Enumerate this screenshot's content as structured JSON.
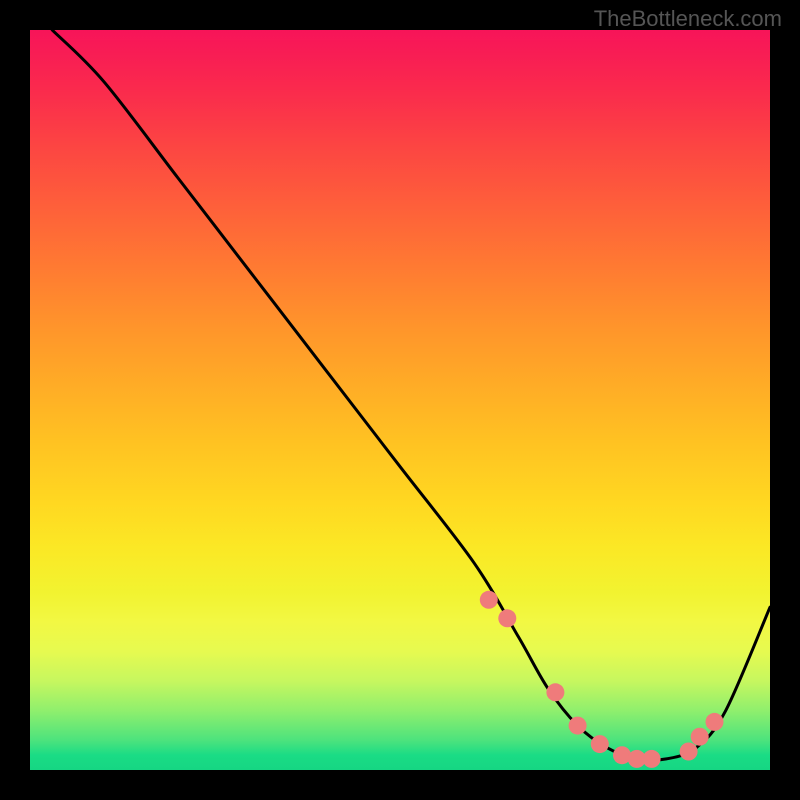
{
  "watermark": "TheBottleneck.com",
  "chart_data": {
    "type": "line",
    "title": "",
    "xlabel": "",
    "ylabel": "",
    "xlim": [
      0,
      100
    ],
    "ylim": [
      0,
      100
    ],
    "series": [
      {
        "name": "curve",
        "x": [
          3,
          10,
          20,
          30,
          40,
          50,
          60,
          66,
          70,
          74,
          78,
          82,
          86,
          90,
          94,
          100
        ],
        "values": [
          100,
          93,
          80,
          67,
          54,
          41,
          28,
          18,
          11,
          6,
          3,
          1.5,
          1.5,
          3,
          8,
          22
        ]
      }
    ],
    "markers": {
      "name": "highlight-dots",
      "color": "#ef7b7b",
      "x": [
        62,
        64.5,
        71,
        74,
        77,
        80,
        82,
        84,
        89,
        90.5,
        92.5
      ],
      "values": [
        23,
        20.5,
        10.5,
        6,
        3.5,
        2,
        1.5,
        1.5,
        2.5,
        4.5,
        6.5
      ]
    }
  }
}
